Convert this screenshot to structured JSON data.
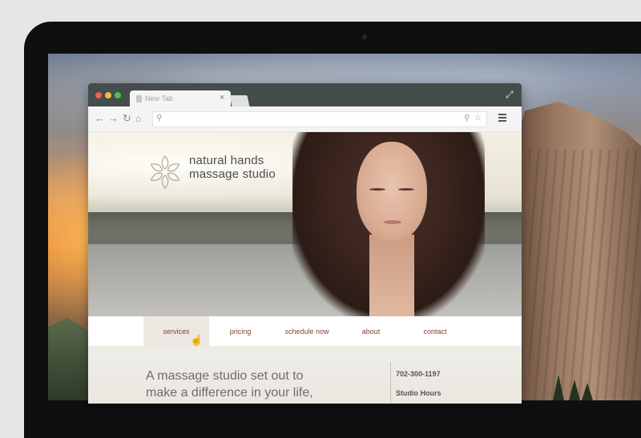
{
  "browser": {
    "tab_label": "New Tab",
    "tab_close": "×",
    "url_value": "",
    "url_placeholder": ""
  },
  "site": {
    "brand_line1": "natural hands",
    "brand_line2": "massage studio",
    "nav": [
      {
        "label": "services",
        "active": true
      },
      {
        "label": "pricing",
        "active": false
      },
      {
        "label": "schedule now",
        "active": false
      },
      {
        "label": "about",
        "active": false
      },
      {
        "label": "contact",
        "active": false
      }
    ],
    "tagline_line1": "A massage studio set out to",
    "tagline_line2": "make a difference in your life,",
    "phone": "702-300-1197",
    "hours_label": "Studio Hours"
  },
  "icons": {
    "back": "back-arrow-icon",
    "forward": "forward-arrow-icon",
    "reload": "reload-icon",
    "home": "home-icon",
    "search": "search-icon",
    "zoom": "magnifier-icon",
    "star": "star-icon",
    "menu": "hamburger-menu-icon",
    "expand": "fullscreen-icon",
    "cursor": "hand-pointer-icon"
  },
  "colors": {
    "titlebar": "#434d4c",
    "nav_text": "#8a3b30",
    "close": "#f25b52",
    "minimize": "#f6b73c",
    "maximize": "#4ec146"
  }
}
